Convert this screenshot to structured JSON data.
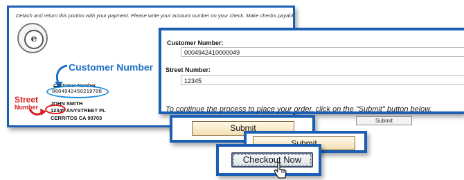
{
  "bill": {
    "instructions": "Detach and return this portion with your payment.  Please write your account number on your check.  Make checks payable t",
    "seal_glyph": "e",
    "customer_callout": "Customer Number",
    "customer_heading": "Customer Number",
    "customer_number": "0004942456219708",
    "street_callout_line1": "Street",
    "street_callout_line2": "Number",
    "name": "JOHN SMITH",
    "street_number": "12345",
    "street_name": " ANYSTREET PL",
    "city_line": "CERRITOS CA 90703"
  },
  "form": {
    "customer_label": "Customer Number:",
    "customer_value": "0004942410000049",
    "street_label": "Street Number:",
    "street_value": "12345",
    "instruction": "To continue the process to place your order, click on the \"Submit\" button below.",
    "submit_small": "Submit"
  },
  "popups": {
    "submit_1": "Submit",
    "submit_2": "Submit",
    "checkout": "Checkout Now"
  },
  "colors": {
    "frame_blue": "#1a5fb4",
    "callout_blue": "#1a6fc4",
    "callout_red": "#d81e1e"
  }
}
